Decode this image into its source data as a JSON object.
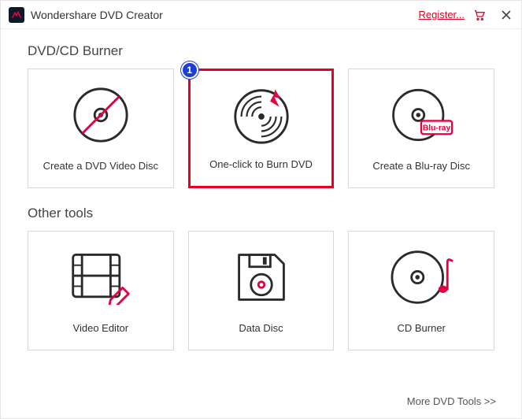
{
  "titlebar": {
    "app_name": "Wondershare DVD Creator",
    "register_label": "Register..."
  },
  "sections": {
    "burner_title": "DVD/CD Burner",
    "other_title": "Other tools"
  },
  "tiles": {
    "dvd_video": "Create a DVD Video Disc",
    "one_click": "One-click to Burn DVD",
    "bluray": "Create a Blu-ray Disc",
    "video_editor": "Video Editor",
    "data_disc": "Data Disc",
    "cd_burner": "CD Burner",
    "bluray_badge": "Blu-ray"
  },
  "footer": {
    "more_tools": "More DVD Tools >>"
  },
  "annotation": {
    "step_number": "1"
  },
  "colors": {
    "accent": "#e60023",
    "badge": "#1b3fd6"
  }
}
